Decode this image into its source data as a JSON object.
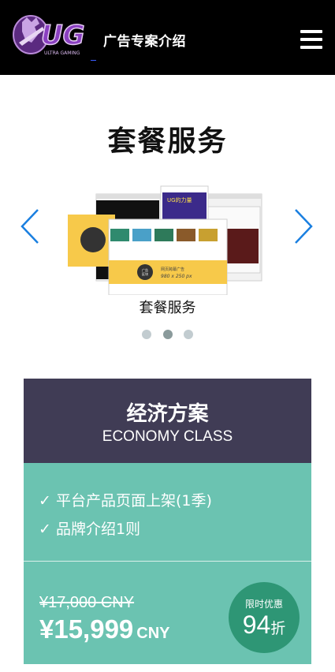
{
  "header": {
    "logo_text": "UG",
    "logo_tagline": "ULTRA GAMING",
    "title": "广告专案介绍",
    "menu_icon": "hamburger-menu-icon"
  },
  "section": {
    "title": "套餐服务"
  },
  "carousel": {
    "prev_icon": "chevron-left-icon",
    "next_icon": "chevron-right-icon",
    "caption": "套餐服务",
    "slide_count": 3,
    "active_index": 1,
    "slide_text": {
      "banner_size": "980 x 250 px",
      "banner_label": "网页跨幕广告",
      "ad_label": "广告",
      "ad_label2": "区块",
      "promo": "UG的力量"
    }
  },
  "plan": {
    "name": "经济方案",
    "class_name": "ECONOMY CLASS",
    "features": [
      "✓ 平台产品页面上架(1季)",
      "✓ 品牌介绍1则"
    ],
    "old_price": "¥17,000 CNY",
    "new_price": "¥15,999",
    "currency": "CNY",
    "badge_label": "限时优惠",
    "badge_value": "94",
    "badge_unit": "折"
  },
  "colors": {
    "header_bg": "#000000",
    "plan_head_bg": "#403c55",
    "plan_body_bg": "#6bc3b1",
    "badge_bg": "#2e9675",
    "arrow": "#1a7fe0",
    "logo_purple": "#7a3aa0"
  }
}
